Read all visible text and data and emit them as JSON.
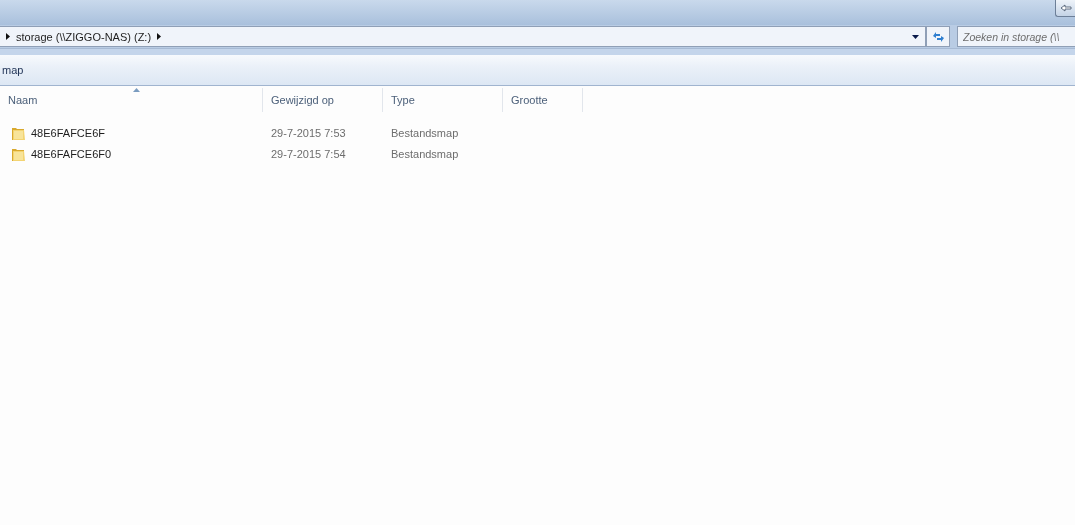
{
  "address_bar": {
    "path": "storage (\\\\ZIGGO-NAS) (Z:)"
  },
  "search": {
    "placeholder": "Zoeken in storage (\\\\"
  },
  "toolbar": {
    "items": [
      "map"
    ]
  },
  "table": {
    "columns": [
      {
        "label": "Naam",
        "sorted": true
      },
      {
        "label": "Gewijzigd op",
        "sorted": false
      },
      {
        "label": "Type",
        "sorted": false
      },
      {
        "label": "Grootte",
        "sorted": false
      }
    ],
    "rows": [
      {
        "name": "48E6FAFCE6F",
        "modified": "29-7-2015 7:53",
        "type": "Bestandsmap"
      },
      {
        "name": "48E6FAFCE6F0",
        "modified": "29-7-2015 7:54",
        "type": "Bestandsmap"
      }
    ]
  }
}
